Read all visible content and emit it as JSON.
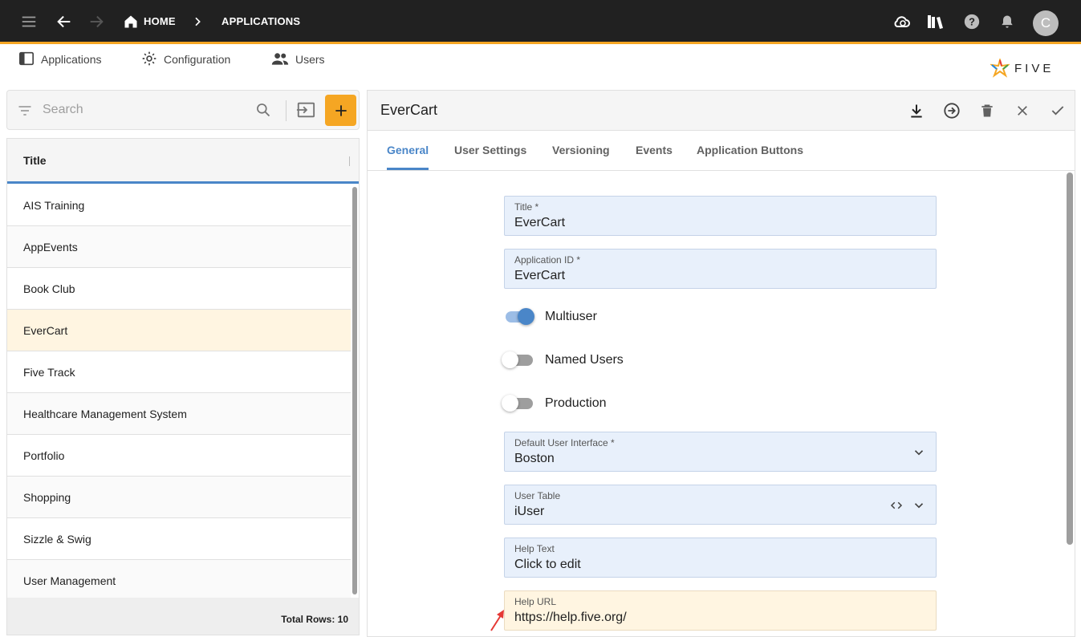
{
  "topbar": {
    "breadcrumb_home": "HOME",
    "breadcrumb_current": "APPLICATIONS",
    "avatar_letter": "C"
  },
  "nav": {
    "tabs": [
      {
        "label": "Applications",
        "icon": "window-icon"
      },
      {
        "label": "Configuration",
        "icon": "gear-icon"
      },
      {
        "label": "Users",
        "icon": "users-icon"
      }
    ],
    "logo_text": "FIVE"
  },
  "list": {
    "search_placeholder": "Search",
    "column_title": "Title",
    "items": [
      "AIS Training",
      "AppEvents",
      "Book Club",
      "EverCart",
      "Five Track",
      "Healthcare Management System",
      "Portfolio",
      "Shopping",
      "Sizzle & Swig",
      "User Management"
    ],
    "selected": "EverCart",
    "total_rows": "Total Rows: 10"
  },
  "form": {
    "title": "EverCart",
    "tabs": [
      "General",
      "User Settings",
      "Versioning",
      "Events",
      "Application Buttons"
    ],
    "active_tab": "General",
    "fields": {
      "title": {
        "label": "Title *",
        "value": "EverCart"
      },
      "app_id": {
        "label": "Application ID *",
        "value": "EverCart"
      },
      "default_ui": {
        "label": "Default User Interface *",
        "value": "Boston"
      },
      "user_table": {
        "label": "User Table",
        "value": "iUser"
      },
      "help_text": {
        "label": "Help Text",
        "value": "Click to edit"
      },
      "help_url": {
        "label": "Help URL",
        "value": "https://help.five.org/"
      }
    },
    "toggles": {
      "multiuser": {
        "label": "Multiuser",
        "on": true
      },
      "named_users": {
        "label": "Named Users",
        "on": false
      },
      "production": {
        "label": "Production",
        "on": false
      }
    }
  },
  "colors": {
    "accent_orange": "#f5a623",
    "accent_blue": "#4a86c8",
    "topbar_bg": "#212121",
    "field_bg": "#e8f0fb",
    "highlight_bg": "#fff5e1"
  }
}
